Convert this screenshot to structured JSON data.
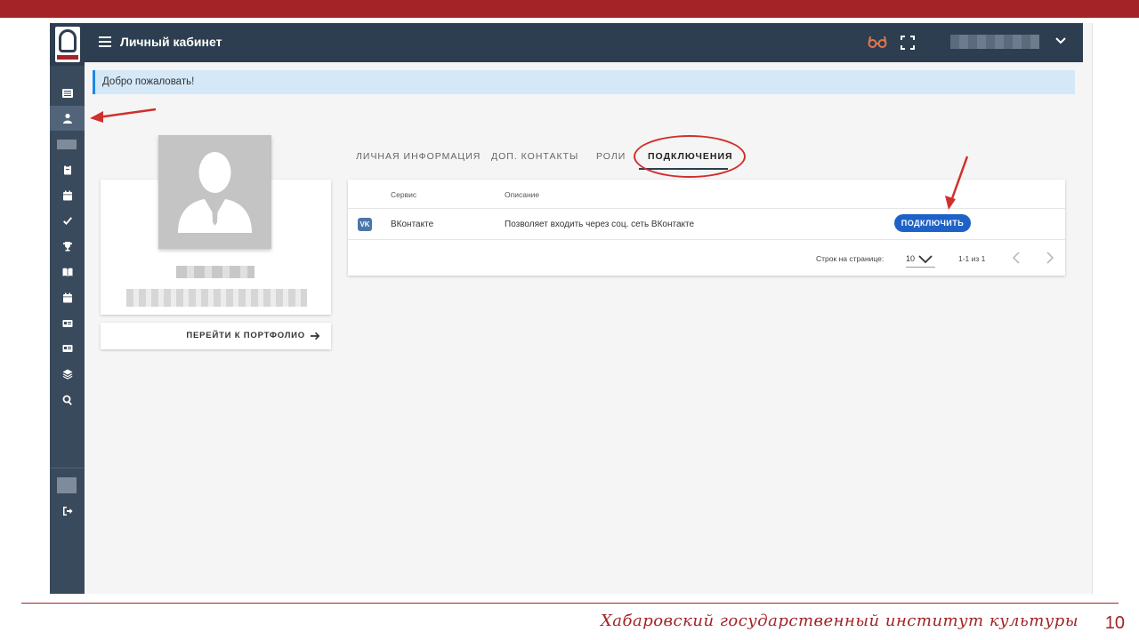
{
  "colors": {
    "brand_red": "#a32326",
    "appbar": "#2c3e50",
    "sidebar": "#3a4a5d",
    "accent_blue": "#1e62c8",
    "welcome_bg": "#d4e8f8",
    "vk_blue": "#4a76a8"
  },
  "appbar": {
    "title": "Личный кабинет",
    "menu_icon": "hamburger-icon",
    "glasses_icon": "glasses-icon",
    "fullscreen_icon": "fullscreen-icon"
  },
  "welcome": {
    "text": "Добро пожаловать!"
  },
  "sidebar": {
    "items": [
      "list-icon",
      "user-icon",
      "clipboard-icon",
      "calendar-icon",
      "check-icon",
      "trophy-icon",
      "book-icon",
      "calendar-icon",
      "id-card-icon",
      "id-card-icon",
      "layers-icon",
      "search-icon"
    ],
    "logout_icon": "logout-icon"
  },
  "profile": {
    "portfolio_button": "ПЕРЕЙТИ К ПОРТФОЛИО"
  },
  "tabs": [
    {
      "label": "ЛИЧНАЯ ИНФОРМАЦИЯ"
    },
    {
      "label": "ДОП. КОНТАКТЫ"
    },
    {
      "label": "РОЛИ"
    },
    {
      "label": "ПОДКЛЮЧЕНИЯ"
    }
  ],
  "table": {
    "headers": {
      "service": "Сервис",
      "description": "Описание"
    },
    "rows": [
      {
        "icon": "VK",
        "service": "ВКонтакте",
        "description": "Позволяет входить через соц. сеть ВКонтакте",
        "action": "ПОДКЛЮЧИТЬ"
      }
    ],
    "footer": {
      "rows_per_page_label": "Строк на странице:",
      "rows_per_page_value": "10",
      "range": "1-1 из 1"
    }
  },
  "slide": {
    "institute": "Хабаровский государственный институт культуры",
    "page_number": "10"
  }
}
